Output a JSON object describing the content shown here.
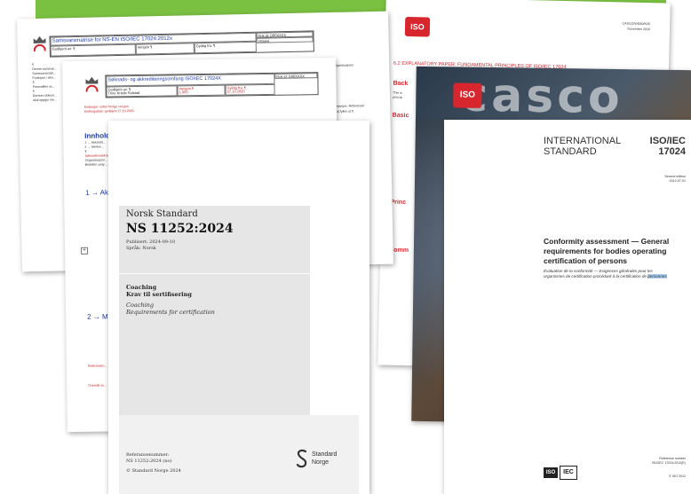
{
  "doc1": {
    "title": "Samsvarsmatrise for NS-EN ISO/IEC 17024:2012x",
    "doc_id": "Dok.id: D00XXXX",
    "version_label": "Versjon ¶",
    "godkjent_label": "Godkjent av: ¶",
    "gyldig_label": "Gyldig fra: ¶",
    "status_label": "Utgave",
    "org_label": "NORSK AKKREDITERING",
    "text_lines": [
      "¶",
      "Denne samsvar...",
      "Samsvarsmatri...",
      "Funksjon i den...",
      "¶",
      "Fremstillen av...",
      "¶",
      "Dersom dokum...",
      "skal oppgis me..."
    ],
    "right_text_1": "itfisystem eller i organisasjons",
    "right_text_2": "ge dokumentasjon. Referanser",
    "right_text_3": "(useful tekst) fylles ut ¶"
  },
  "doc2": {
    "title": "Søknads- og akkrediteringsomfang ISO/IEC 17024X",
    "doc_id": "Dok.id: D00XXXX",
    "godkjent": "Godkjent av: ¶",
    "godkjent_val": "Trine Kristin Solstad",
    "versjon": "Versjon ¶",
    "versjon_val": "1.000",
    "gyldig": "Gyldig fra: ¶",
    "gyldig_val": "27.10.2020",
    "org_label": "NORSK AKKREDITERING",
    "endringer": "Endringer: siden forrige versjon",
    "endringer2": "Endringsdato: godkjent 27.10.2020",
    "innhold": "Innhold",
    "item1": "1 → Akkr...",
    "item2": "2 → Mark...",
    "lines": [
      "1 → Akkredit...",
      "2 → Merkin...",
      "¶",
      "Søknaden/akkreditering...",
      "Organisasjon/...",
      "Bedrifts/ unity:..."
    ],
    "sect_1": "1 → Akkr",
    "sect_2": "2 → Mark",
    "ref_label": "Referansen...",
    "oversikt": "Oversikt av..."
  },
  "doc3": {
    "heading": "Norsk Standard",
    "number": "NS 11252:2024",
    "published": "Publisert: 2024-09-10",
    "language": "Språk: Norsk",
    "title_no": "Coaching",
    "subtitle_no": "Krav til sertifisering",
    "title_en": "Coaching",
    "subtitle_en": "Requirements for certification",
    "ref_label": "Referansenummer:",
    "ref_number": "NS 11252:2024 (no)",
    "copyright": "© Standard Norge 2024",
    "brand_top": "Standard",
    "brand_bottom": "Norge"
  },
  "doc4": {
    "iso_logo": "ISO",
    "ref_line1": "CASCO/WG60/N35",
    "ref_line2": "November 2020",
    "section": "6.2 EXPLANATORY PAPER: FUNDAMENTAL PRINCIPLES OF ISO/IEC 17024",
    "back": "Back",
    "basic": "Basic",
    "princ": "Princ",
    "comm": "Comm",
    "lines": [
      "This is",
      "princip"
    ]
  },
  "doc5": {
    "iso_logo": "ISO",
    "word": "casco"
  },
  "doc6": {
    "line1": "INTERNATIONAL",
    "line2": "STANDARD",
    "code1": "ISO/IEC",
    "code2": "17024",
    "edition1": "Second edition",
    "edition2": "2012-07-01",
    "title1": "Conformity assessment — General",
    "title2": "requirements for bodies operating",
    "title3": "certification of persons",
    "fr1": "Évaluation de la conformité — Exigences générales pour les",
    "fr2": "organismes de certification procédant à la certification de personnes",
    "ref_label": "Reference number",
    "ref_number": "ISO/IEC 17024:2012(E)",
    "iso_logo": "ISO",
    "iec_logo": "IEC",
    "copyright": "© ISO 2012"
  }
}
